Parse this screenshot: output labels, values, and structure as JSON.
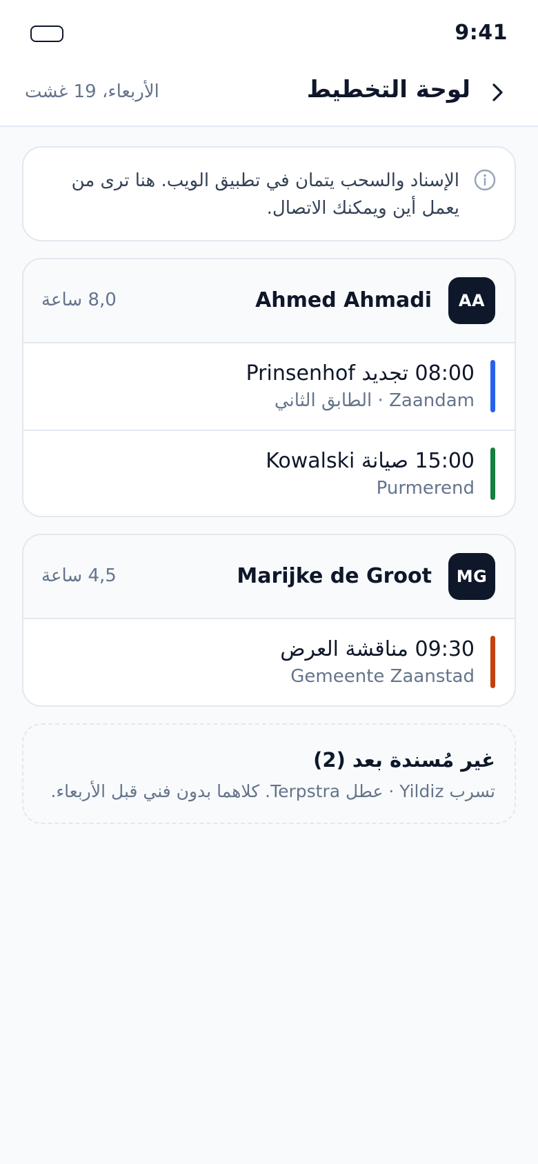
{
  "status_bar": {
    "time": "9:41"
  },
  "header": {
    "title": "لوحة التخطيط",
    "date": "الأربعاء، 19 غشت",
    "back_icon": "chevron-right-icon"
  },
  "info_banner": {
    "icon": "info-icon",
    "text": "الإسناد والسحب يتمان في تطبيق الويب. هنا ترى من يعمل أين ويمكنك الاتصال."
  },
  "people": [
    {
      "initials": "AA",
      "name": "Ahmed Ahmadi",
      "hours": "8,0 ساعة",
      "jobs": [
        {
          "title": "08:00 تجديد Prinsenhof",
          "subtitle": "Zaandam · الطابق الثاني",
          "color": "#2563eb"
        },
        {
          "title": "15:00 صيانة Kowalski",
          "subtitle": "Purmerend",
          "color": "#15803d"
        }
      ]
    },
    {
      "initials": "MG",
      "name": "Marijke de Groot",
      "hours": "4,5 ساعة",
      "jobs": [
        {
          "title": "09:30 مناقشة العرض",
          "subtitle": "Gemeente Zaanstad",
          "color": "#c2410c"
        }
      ]
    }
  ],
  "unassigned": {
    "title": "غير مُسندة بعد (2)",
    "text": "تسرب Yildiz · عطل Terpstra. كلاهما بدون فني قبل الأربعاء."
  }
}
